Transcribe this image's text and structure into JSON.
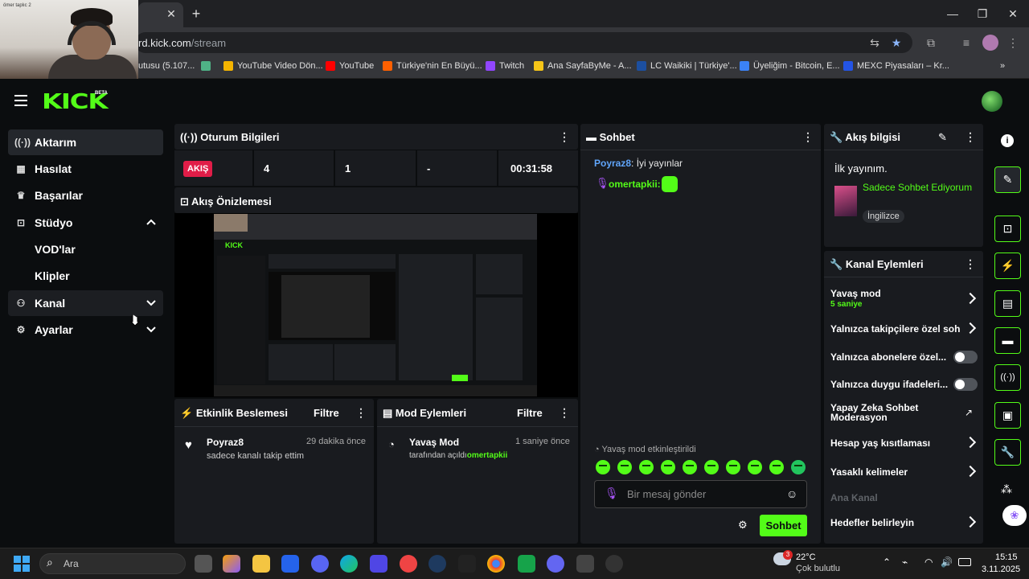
{
  "browser": {
    "url_prefix": "rd.kick.com",
    "url_path": "/stream",
    "new_tab": "+",
    "close_tab": "✕",
    "bookmarks": [
      {
        "label": "utusu (5.107...",
        "icon_color": "#888"
      },
      {
        "label": "",
        "icon_color": "#4fb286"
      },
      {
        "label": "YouTube Video Dön...",
        "icon_color": "#f4b400"
      },
      {
        "label": "YouTube",
        "icon_color": "#ff0000"
      },
      {
        "label": "Türkiye'nin En Büyü...",
        "icon_color": "#ff6000"
      },
      {
        "label": "Twitch",
        "icon_color": "#9146ff"
      },
      {
        "label": "Ana SayfaByMe - A...",
        "icon_color": "#f5c518"
      },
      {
        "label": "LC Waikiki | Türkiye'...",
        "icon_color": "#1c4fa0"
      },
      {
        "label": "Üyeliğim - Bitcoin, E...",
        "icon_color": "#3b82f6"
      },
      {
        "label": "MEXC Piyasaları – Kr...",
        "icon_color": "#2354e6"
      }
    ],
    "bookmark_more": "»"
  },
  "webcam": {
    "overlay_text": "ömer taplıc 2"
  },
  "app": {
    "logo": "KICK",
    "logo_badge": "BETA"
  },
  "sidebar": {
    "items": [
      {
        "label": "Aktarım",
        "icon": "broadcast-icon"
      },
      {
        "label": "Hasılat",
        "icon": "revenue-icon"
      },
      {
        "label": "Başarılar",
        "icon": "trophy-icon"
      },
      {
        "label": "Stüdyo",
        "icon": "studio-icon"
      },
      {
        "label": "Kanal",
        "icon": "channel-icon"
      },
      {
        "label": "Ayarlar",
        "icon": "gear-icon"
      }
    ],
    "studio_sub": [
      "VOD'lar",
      "Klipler"
    ]
  },
  "session": {
    "title": "Oturum Bilgileri",
    "badge": "AKIŞ",
    "stats": [
      "4",
      "1",
      "-",
      "00:31:58"
    ]
  },
  "preview": {
    "title": "Akış Önizlemesi"
  },
  "events": {
    "title": "Etkinlik Beslemesi",
    "filter": "Filtre",
    "items": [
      {
        "user": "Poyraz8",
        "time": "29 dakika önce",
        "desc": "sadece kanalı takip ettim"
      }
    ]
  },
  "mod": {
    "title": "Mod Eylemleri",
    "filter": "Filtre",
    "items": [
      {
        "action": "Yavaş Mod",
        "time": "1 saniye önce",
        "desc_prefix": "tarafından açıldı",
        "by": "omertapkii"
      }
    ]
  },
  "chat": {
    "title": "Sohbet",
    "messages": [
      {
        "user": "Poyraz8",
        "text": ": İyi yayınlar",
        "color": "#60a5fa"
      },
      {
        "user": "omertapkii:",
        "text": "",
        "color": "#53fc18"
      }
    ],
    "slow_mode_notice": "Yavaş mod etkinleştirildi",
    "placeholder": "Bir mesaj gönder",
    "send": "Sohbet"
  },
  "stream_info": {
    "title": "Akış bilgisi",
    "stream_title": "İlk yayınım.",
    "category": "Sadece Sohbet Ediyorum",
    "language": "İngilizce"
  },
  "channel_actions": {
    "title": "Kanal Eylemleri",
    "slow_mode": "Yavaş mod",
    "slow_mode_value": "5 saniye",
    "followers_only": "Yalnızca takipçilere özel soh",
    "subs_only": "Yalnızca abonelere özel...",
    "emotes_only": "Yalnızca duygu ifadeleri...",
    "ai_moderation": "Yapay Zeka Sohbet Moderasyon",
    "age_restriction": "Hesap yaş kısıtlaması",
    "banned_words": "Yasaklı kelimeler",
    "main_channel": "Ana Kanal",
    "set_goals": "Hedefler belirleyin",
    "toggles": {
      "subs_only": false,
      "emotes_only": false
    }
  },
  "taskbar": {
    "search_placeholder": "Ara",
    "weather_temp": "22°C",
    "weather_desc": "Çok bulutlu",
    "weather_badge": "3",
    "time": "15:15",
    "date": "3.11.2025"
  }
}
